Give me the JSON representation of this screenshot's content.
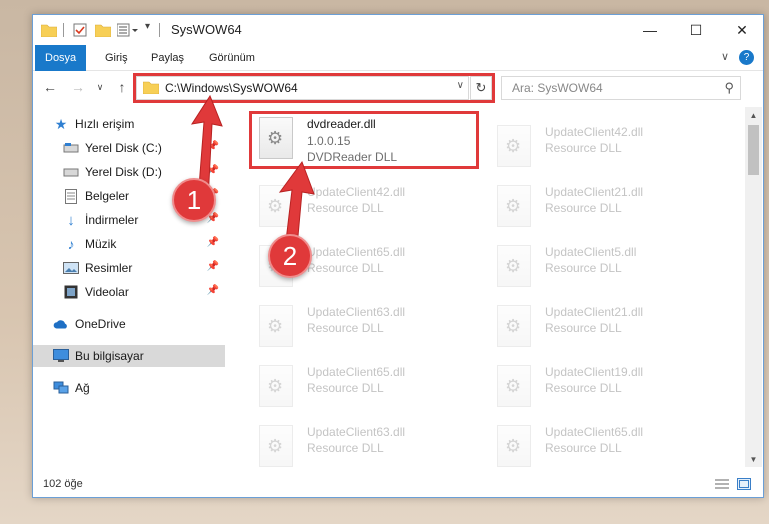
{
  "window": {
    "title": "SysWOW64",
    "controls": {
      "minimize": "—",
      "maximize": "☐",
      "close": "✕"
    }
  },
  "ribbon": {
    "tabs": [
      {
        "label": "Dosya",
        "active": true
      },
      {
        "label": "Giriş"
      },
      {
        "label": "Paylaş"
      },
      {
        "label": "Görünüm"
      }
    ],
    "expand_icon": "chevron-down-icon",
    "help_icon": "help-icon"
  },
  "nav": {
    "back": "←",
    "forward": "→",
    "recent": "∨",
    "up": "↑",
    "address": "C:\\Windows\\SysWOW64",
    "refresh": "↻",
    "search_placeholder": "Ara: SysWOW64"
  },
  "sidebar": {
    "items": [
      {
        "label": "Hızlı erişim",
        "icon": "star-icon"
      },
      {
        "label": "Yerel Disk (C:)",
        "icon": "drive-icon",
        "pinned": true
      },
      {
        "label": "Yerel Disk (D:)",
        "icon": "drive-icon",
        "pinned": true
      },
      {
        "label": "Belgeler",
        "icon": "documents-icon",
        "pinned": true
      },
      {
        "label": "İndirmeler",
        "icon": "download-icon",
        "pinned": true
      },
      {
        "label": "Müzik",
        "icon": "music-icon",
        "pinned": true
      },
      {
        "label": "Resimler",
        "icon": "pictures-icon",
        "pinned": true
      },
      {
        "label": "Videolar",
        "icon": "videos-icon",
        "pinned": true
      },
      {
        "label": "OneDrive",
        "icon": "cloud-icon"
      },
      {
        "label": "Bu bilgisayar",
        "icon": "computer-icon",
        "selected": true
      },
      {
        "label": "Ağ",
        "icon": "network-icon"
      }
    ]
  },
  "files": {
    "highlighted": {
      "name": "dvdreader.dll",
      "version": "1.0.0.15",
      "desc": "DVDReader DLL"
    },
    "left_column": [
      {
        "name": "UpdateClient42.dll",
        "desc": "Resource DLL"
      },
      {
        "name": "UpdateClient65.dll",
        "desc": "Resource DLL"
      },
      {
        "name": "UpdateClient63.dll",
        "desc": "Resource DLL"
      },
      {
        "name": "UpdateClient65.dll",
        "desc": "Resource DLL"
      },
      {
        "name": "UpdateClient63.dll",
        "desc": "Resource DLL"
      }
    ],
    "right_column": [
      {
        "name": "UpdateClient42.dll",
        "desc": "Resource DLL"
      },
      {
        "name": "UpdateClient21.dll",
        "desc": "Resource DLL"
      },
      {
        "name": "UpdateClient5.dll",
        "desc": "Resource DLL"
      },
      {
        "name": "UpdateClient21.dll",
        "desc": "Resource DLL"
      },
      {
        "name": "UpdateClient19.dll",
        "desc": "Resource DLL"
      },
      {
        "name": "UpdateClient65.dll",
        "desc": "Resource DLL"
      }
    ]
  },
  "status": {
    "item_count": "102 öğe"
  },
  "annotations": {
    "step1": "1",
    "step2": "2",
    "color": "#e0393a"
  }
}
